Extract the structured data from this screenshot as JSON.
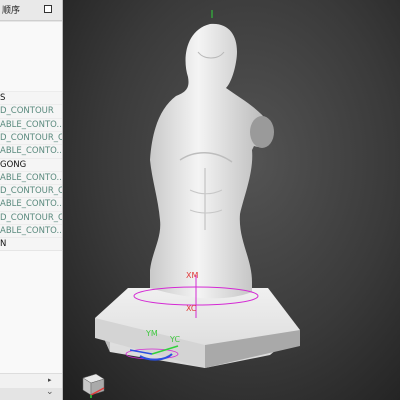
{
  "panel": {
    "title": "顺序",
    "rows": [
      {
        "text": "S",
        "tone": "dark"
      },
      {
        "text": "D_CONTOUR",
        "tone": "grey"
      },
      {
        "text": "ABLE_CONTO...",
        "tone": "grey"
      },
      {
        "text": "D_CONTOUR_C...",
        "tone": "grey"
      },
      {
        "text": "ABLE_CONTO...",
        "tone": "grey"
      },
      {
        "text": "GONG",
        "tone": "dark"
      },
      {
        "text": "ABLE_CONTO...",
        "tone": "grey"
      },
      {
        "text": "D_CONTOUR_C...",
        "tone": "grey"
      },
      {
        "text": "ABLE_CONTO...",
        "tone": "grey"
      },
      {
        "text": "D_CONTOUR_C...",
        "tone": "grey"
      },
      {
        "text": "ABLE_CONTO...",
        "tone": "grey"
      },
      {
        "text": "N",
        "tone": "dark"
      }
    ],
    "scroll_arrow": "▸",
    "footer_chevron": "⌄"
  },
  "viewport": {
    "labels": {
      "xm": "XM",
      "xc": "XC",
      "ym": "YM",
      "yc": "YC"
    },
    "colors": {
      "label": "#e03c3c",
      "label_green": "#42c842",
      "ring": "#d42ad4",
      "axis_green": "#2fd23b",
      "axis_blue": "#2a4fe0"
    }
  }
}
